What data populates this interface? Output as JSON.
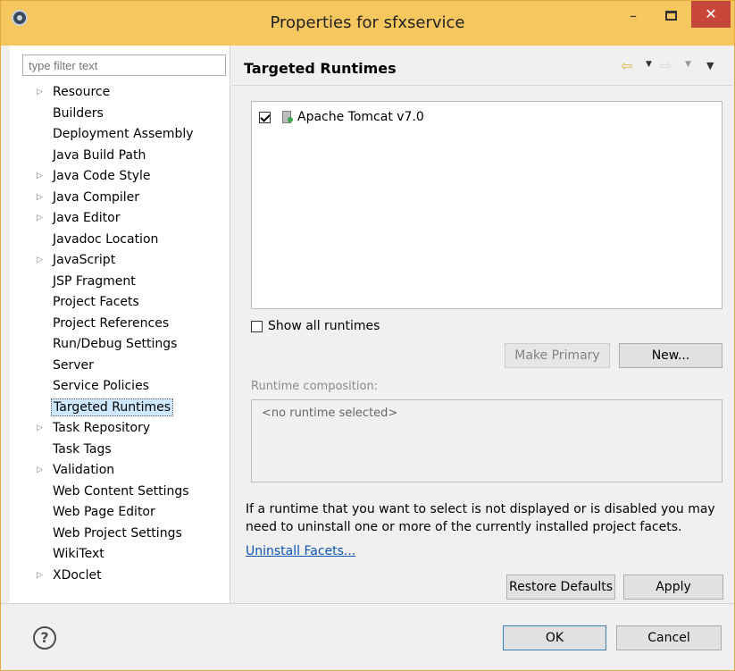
{
  "window": {
    "title": "Properties for sfxservice",
    "minimize_label": "–",
    "close_label": "✕"
  },
  "sidebar": {
    "filter_placeholder": "type filter text",
    "items": [
      {
        "label": "Resource",
        "expandable": true
      },
      {
        "label": "Builders",
        "expandable": false
      },
      {
        "label": "Deployment Assembly",
        "expandable": false
      },
      {
        "label": "Java Build Path",
        "expandable": false
      },
      {
        "label": "Java Code Style",
        "expandable": true
      },
      {
        "label": "Java Compiler",
        "expandable": true
      },
      {
        "label": "Java Editor",
        "expandable": true
      },
      {
        "label": "Javadoc Location",
        "expandable": false
      },
      {
        "label": "JavaScript",
        "expandable": true
      },
      {
        "label": "JSP Fragment",
        "expandable": false
      },
      {
        "label": "Project Facets",
        "expandable": false
      },
      {
        "label": "Project References",
        "expandable": false
      },
      {
        "label": "Run/Debug Settings",
        "expandable": false
      },
      {
        "label": "Server",
        "expandable": false
      },
      {
        "label": "Service Policies",
        "expandable": false
      },
      {
        "label": "Targeted Runtimes",
        "expandable": false,
        "selected": true
      },
      {
        "label": "Task Repository",
        "expandable": true
      },
      {
        "label": "Task Tags",
        "expandable": false
      },
      {
        "label": "Validation",
        "expandable": true
      },
      {
        "label": "Web Content Settings",
        "expandable": false
      },
      {
        "label": "Web Page Editor",
        "expandable": false
      },
      {
        "label": "Web Project Settings",
        "expandable": false
      },
      {
        "label": "WikiText",
        "expandable": false
      },
      {
        "label": "XDoclet",
        "expandable": true
      }
    ]
  },
  "main": {
    "title": "Targeted Runtimes",
    "runtimes": [
      {
        "label": "Apache Tomcat v7.0",
        "checked": true
      }
    ],
    "show_all_label": "Show all runtimes",
    "make_primary_label": "Make Primary",
    "new_label": "New...",
    "composition_label": "Runtime composition:",
    "composition_placeholder": "<no runtime selected>",
    "info_text": "If a runtime that you want to select is not displayed or is disabled you may need to uninstall one or more of the currently installed project facets.",
    "uninstall_link": "Uninstall Facets...",
    "restore_defaults_label": "Restore Defaults",
    "apply_label": "Apply"
  },
  "footer": {
    "ok_label": "OK",
    "cancel_label": "Cancel"
  },
  "colors": {
    "title_bar": "#f6c65f",
    "close_button": "#c7463a",
    "selection": "#cde8ff",
    "link": "#0b53b7"
  }
}
